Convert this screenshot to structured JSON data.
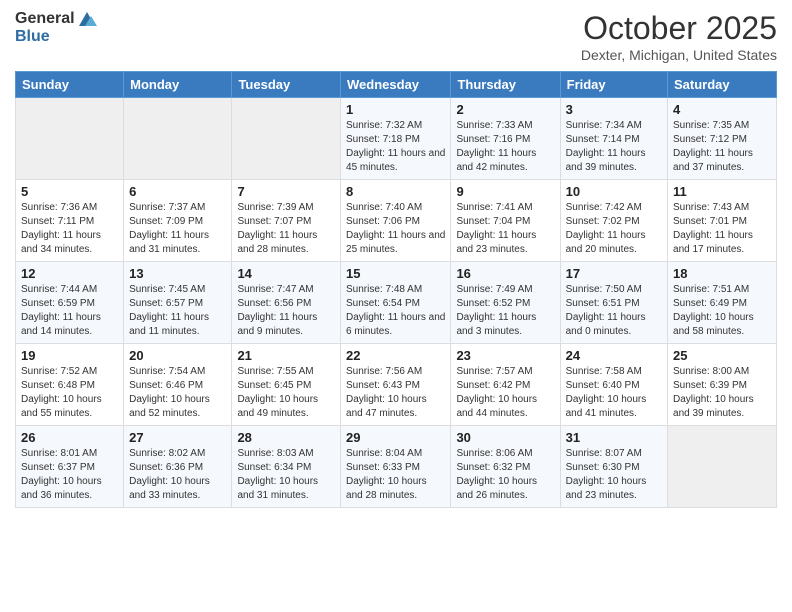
{
  "header": {
    "logo": {
      "general": "General",
      "blue": "Blue"
    },
    "title": "October 2025",
    "subtitle": "Dexter, Michigan, United States"
  },
  "calendar": {
    "days_of_week": [
      "Sunday",
      "Monday",
      "Tuesday",
      "Wednesday",
      "Thursday",
      "Friday",
      "Saturday"
    ],
    "weeks": [
      [
        {
          "day": "",
          "info": ""
        },
        {
          "day": "",
          "info": ""
        },
        {
          "day": "",
          "info": ""
        },
        {
          "day": "1",
          "info": "Sunrise: 7:32 AM\nSunset: 7:18 PM\nDaylight: 11 hours and 45 minutes."
        },
        {
          "day": "2",
          "info": "Sunrise: 7:33 AM\nSunset: 7:16 PM\nDaylight: 11 hours and 42 minutes."
        },
        {
          "day": "3",
          "info": "Sunrise: 7:34 AM\nSunset: 7:14 PM\nDaylight: 11 hours and 39 minutes."
        },
        {
          "day": "4",
          "info": "Sunrise: 7:35 AM\nSunset: 7:12 PM\nDaylight: 11 hours and 37 minutes."
        }
      ],
      [
        {
          "day": "5",
          "info": "Sunrise: 7:36 AM\nSunset: 7:11 PM\nDaylight: 11 hours and 34 minutes."
        },
        {
          "day": "6",
          "info": "Sunrise: 7:37 AM\nSunset: 7:09 PM\nDaylight: 11 hours and 31 minutes."
        },
        {
          "day": "7",
          "info": "Sunrise: 7:39 AM\nSunset: 7:07 PM\nDaylight: 11 hours and 28 minutes."
        },
        {
          "day": "8",
          "info": "Sunrise: 7:40 AM\nSunset: 7:06 PM\nDaylight: 11 hours and 25 minutes."
        },
        {
          "day": "9",
          "info": "Sunrise: 7:41 AM\nSunset: 7:04 PM\nDaylight: 11 hours and 23 minutes."
        },
        {
          "day": "10",
          "info": "Sunrise: 7:42 AM\nSunset: 7:02 PM\nDaylight: 11 hours and 20 minutes."
        },
        {
          "day": "11",
          "info": "Sunrise: 7:43 AM\nSunset: 7:01 PM\nDaylight: 11 hours and 17 minutes."
        }
      ],
      [
        {
          "day": "12",
          "info": "Sunrise: 7:44 AM\nSunset: 6:59 PM\nDaylight: 11 hours and 14 minutes."
        },
        {
          "day": "13",
          "info": "Sunrise: 7:45 AM\nSunset: 6:57 PM\nDaylight: 11 hours and 11 minutes."
        },
        {
          "day": "14",
          "info": "Sunrise: 7:47 AM\nSunset: 6:56 PM\nDaylight: 11 hours and 9 minutes."
        },
        {
          "day": "15",
          "info": "Sunrise: 7:48 AM\nSunset: 6:54 PM\nDaylight: 11 hours and 6 minutes."
        },
        {
          "day": "16",
          "info": "Sunrise: 7:49 AM\nSunset: 6:52 PM\nDaylight: 11 hours and 3 minutes."
        },
        {
          "day": "17",
          "info": "Sunrise: 7:50 AM\nSunset: 6:51 PM\nDaylight: 11 hours and 0 minutes."
        },
        {
          "day": "18",
          "info": "Sunrise: 7:51 AM\nSunset: 6:49 PM\nDaylight: 10 hours and 58 minutes."
        }
      ],
      [
        {
          "day": "19",
          "info": "Sunrise: 7:52 AM\nSunset: 6:48 PM\nDaylight: 10 hours and 55 minutes."
        },
        {
          "day": "20",
          "info": "Sunrise: 7:54 AM\nSunset: 6:46 PM\nDaylight: 10 hours and 52 minutes."
        },
        {
          "day": "21",
          "info": "Sunrise: 7:55 AM\nSunset: 6:45 PM\nDaylight: 10 hours and 49 minutes."
        },
        {
          "day": "22",
          "info": "Sunrise: 7:56 AM\nSunset: 6:43 PM\nDaylight: 10 hours and 47 minutes."
        },
        {
          "day": "23",
          "info": "Sunrise: 7:57 AM\nSunset: 6:42 PM\nDaylight: 10 hours and 44 minutes."
        },
        {
          "day": "24",
          "info": "Sunrise: 7:58 AM\nSunset: 6:40 PM\nDaylight: 10 hours and 41 minutes."
        },
        {
          "day": "25",
          "info": "Sunrise: 8:00 AM\nSunset: 6:39 PM\nDaylight: 10 hours and 39 minutes."
        }
      ],
      [
        {
          "day": "26",
          "info": "Sunrise: 8:01 AM\nSunset: 6:37 PM\nDaylight: 10 hours and 36 minutes."
        },
        {
          "day": "27",
          "info": "Sunrise: 8:02 AM\nSunset: 6:36 PM\nDaylight: 10 hours and 33 minutes."
        },
        {
          "day": "28",
          "info": "Sunrise: 8:03 AM\nSunset: 6:34 PM\nDaylight: 10 hours and 31 minutes."
        },
        {
          "day": "29",
          "info": "Sunrise: 8:04 AM\nSunset: 6:33 PM\nDaylight: 10 hours and 28 minutes."
        },
        {
          "day": "30",
          "info": "Sunrise: 8:06 AM\nSunset: 6:32 PM\nDaylight: 10 hours and 26 minutes."
        },
        {
          "day": "31",
          "info": "Sunrise: 8:07 AM\nSunset: 6:30 PM\nDaylight: 10 hours and 23 minutes."
        },
        {
          "day": "",
          "info": ""
        }
      ]
    ]
  }
}
